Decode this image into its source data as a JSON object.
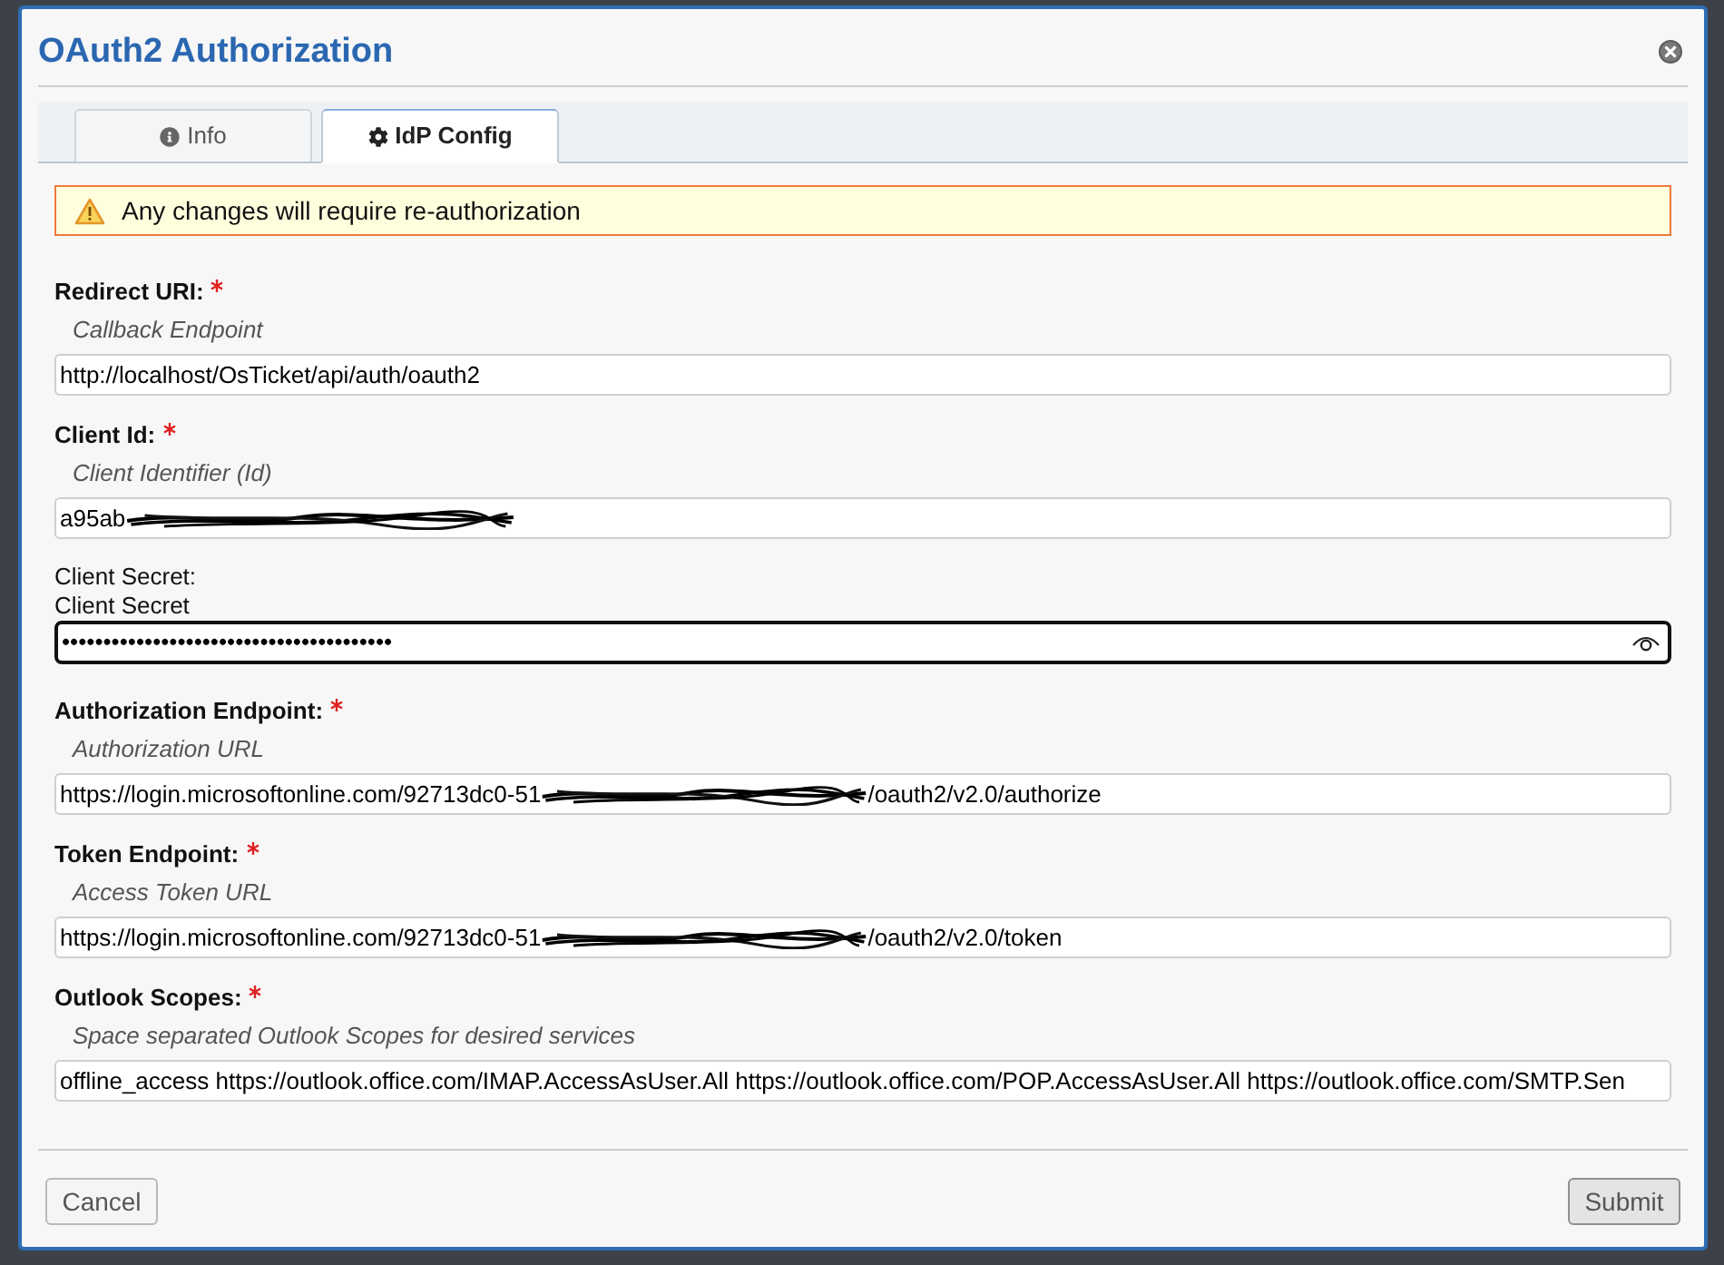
{
  "dialog": {
    "title": "OAuth2 Authorization"
  },
  "tabs": [
    {
      "label": "Info",
      "selected": false
    },
    {
      "label": "IdP Config",
      "selected": true
    }
  ],
  "warning": "Any changes will require re-authorization",
  "fields": [
    {
      "kind": "text",
      "label": "Redirect URI:",
      "required": true,
      "hint": "Callback Endpoint",
      "value": "http://localhost/OsTicket/api/auth/oauth2",
      "redacted": false,
      "focused": false
    },
    {
      "kind": "text",
      "label": "Client Id:",
      "required": true,
      "hint": "Client Identifier (Id)",
      "value": "a95ab",
      "redacted": true,
      "focused": false
    },
    {
      "kind": "password",
      "label": "Client Secret:",
      "required": false,
      "hint": "Client Secret",
      "value": "••••••••••••••••••••••••••••••••••••••••",
      "redacted": false,
      "focused": true
    },
    {
      "kind": "text",
      "label": "Authorization Endpoint:",
      "required": true,
      "hint": "Authorization URL",
      "value": "https://login.microsoftonline.com/92713dc0-51",
      "redacted": true,
      "value_after": "/oauth2/v2.0/authorize",
      "focused": false
    },
    {
      "kind": "text",
      "label": "Token Endpoint:",
      "required": true,
      "hint": "Access Token URL",
      "value": "https://login.microsoftonline.com/92713dc0-51",
      "redacted": true,
      "value_after": "/oauth2/v2.0/token",
      "focused": false
    },
    {
      "kind": "text",
      "label": "Outlook Scopes:",
      "required": true,
      "hint": "Space separated Outlook Scopes for desired services",
      "value": "offline_access https://outlook.office.com/IMAP.AccessAsUser.All https://outlook.office.com/POP.AccessAsUser.All https://outlook.office.com/SMTP.Sen",
      "redacted": false,
      "focused": false
    }
  ],
  "buttons": [
    {
      "label": "Cancel",
      "kind": "secondary"
    },
    {
      "label": "Submit",
      "kind": "primary"
    }
  ]
}
